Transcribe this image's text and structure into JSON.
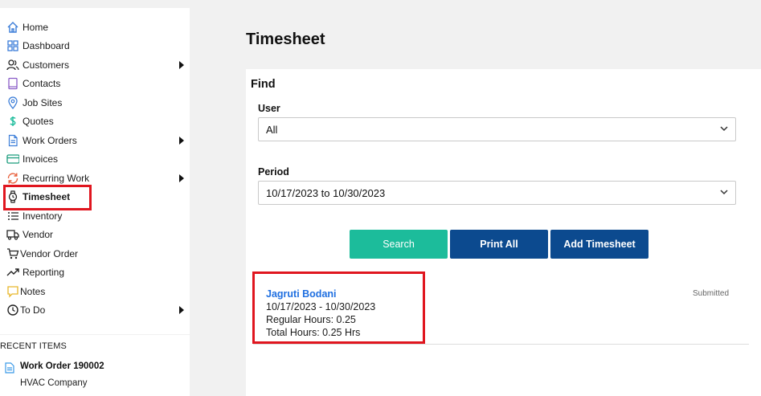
{
  "sidebar": {
    "items": [
      {
        "label": "Home",
        "icon": "home-icon",
        "has_submenu": false
      },
      {
        "label": "Dashboard",
        "icon": "dashboard-grid-icon",
        "has_submenu": false
      },
      {
        "label": "Customers",
        "icon": "customers-icon",
        "has_submenu": true
      },
      {
        "label": "Contacts",
        "icon": "contacts-book-icon",
        "has_submenu": false
      },
      {
        "label": "Job Sites",
        "icon": "map-pin-icon",
        "has_submenu": false
      },
      {
        "label": "Quotes",
        "icon": "dollar-icon",
        "has_submenu": false
      },
      {
        "label": "Work Orders",
        "icon": "document-icon",
        "has_submenu": true
      },
      {
        "label": "Invoices",
        "icon": "credit-card-icon",
        "has_submenu": false
      },
      {
        "label": "Recurring Work",
        "icon": "recurring-icon",
        "has_submenu": true
      },
      {
        "label": "Timesheet",
        "icon": "watch-icon",
        "has_submenu": false,
        "active": true
      },
      {
        "label": "Inventory",
        "icon": "list-icon",
        "has_submenu": false
      },
      {
        "label": "Vendor",
        "icon": "truck-icon",
        "has_submenu": false
      },
      {
        "label": "Vendor Order",
        "icon": "cart-icon",
        "has_submenu": false
      },
      {
        "label": "Reporting",
        "icon": "trend-icon",
        "has_submenu": false
      },
      {
        "label": "Notes",
        "icon": "note-icon",
        "has_submenu": false
      },
      {
        "label": "To Do",
        "icon": "clock-icon",
        "has_submenu": true
      }
    ]
  },
  "recent": {
    "title": "RECENT ITEMS",
    "items": [
      {
        "title": "Work Order 190002",
        "subtitle": "HVAC Company"
      }
    ]
  },
  "page": {
    "title": "Timesheet"
  },
  "find": {
    "title": "Find",
    "user_label": "User",
    "user_value": "All",
    "period_label": "Period",
    "period_value": "10/17/2023 to 10/30/2023"
  },
  "buttons": {
    "search": "Search",
    "print_all": "Print All",
    "add_timesheet": "Add Timesheet"
  },
  "timesheets": [
    {
      "name": "Jagruti Bodani",
      "range": "10/17/2023 - 10/30/2023",
      "regular_hours": "Regular Hours: 0.25",
      "total_hours": "Total Hours: 0.25 Hrs",
      "status": "Submitted"
    }
  ],
  "colors": {
    "search_button": "#1cbc9b",
    "primary_button": "#0c4a8f",
    "link": "#1f6fe0",
    "highlight": "#e0161f"
  }
}
